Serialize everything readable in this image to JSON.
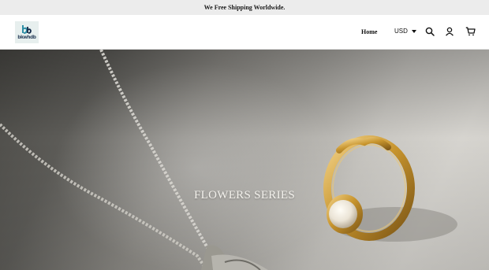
{
  "announcement": {
    "text": "We Free Shipping Worldwide."
  },
  "header": {
    "logo": {
      "text": "bkwhdb"
    },
    "nav": {
      "home_label": "Home"
    },
    "currency": {
      "value": "USD"
    },
    "icons": [
      "search-icon",
      "account-icon",
      "cart-icon"
    ]
  },
  "hero": {
    "title": "FLOWERS SERIES"
  },
  "colors": {
    "announcement_bg": "#ececec",
    "logo_bg": "#e7efee",
    "logo_mark": "#2f8fa6",
    "logo_text": "#142b4a"
  }
}
